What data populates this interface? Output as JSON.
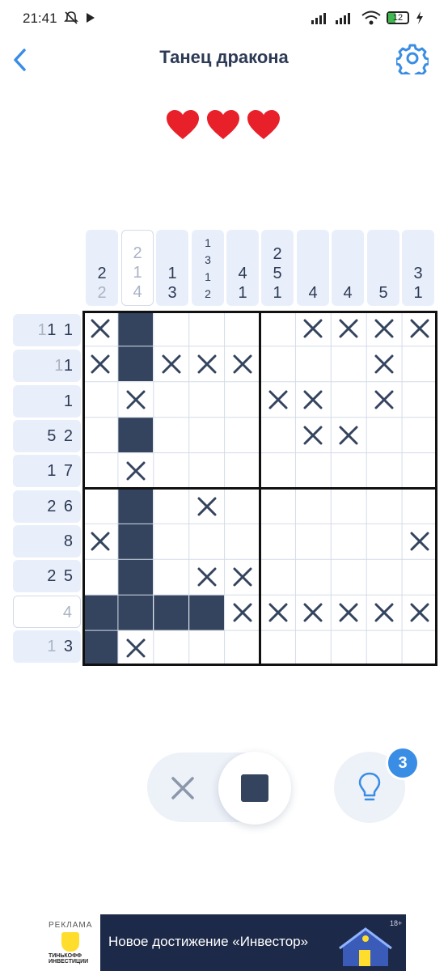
{
  "status_bar": {
    "time": "21:41",
    "battery": "12"
  },
  "header": {
    "title": "Танец дракона"
  },
  "lives": 3,
  "column_clues": [
    {
      "nums": [
        "2",
        "2"
      ],
      "done": false,
      "gray_last": true
    },
    {
      "nums": [
        "2",
        "1",
        "4"
      ],
      "done": true
    },
    {
      "nums": [
        "1",
        "3"
      ],
      "done": false
    },
    {
      "nums": [
        "1",
        "3",
        "1",
        "2"
      ],
      "done": false
    },
    {
      "nums": [
        "4",
        "1"
      ],
      "done": false
    },
    {
      "nums": [
        "2",
        "5",
        "1"
      ],
      "done": false
    },
    {
      "nums": [
        "4"
      ],
      "done": false
    },
    {
      "nums": [
        "4"
      ],
      "done": false
    },
    {
      "nums": [
        "5"
      ],
      "done": false
    },
    {
      "nums": [
        "3",
        "1"
      ],
      "done": false
    }
  ],
  "row_clues": [
    {
      "gray": "1",
      "rest": "1 1",
      "done": false
    },
    {
      "gray": "1",
      "rest": "1",
      "done": false
    },
    {
      "gray": "",
      "rest": "1",
      "done": false
    },
    {
      "gray": "",
      "rest": "5 2",
      "done": false
    },
    {
      "gray": "",
      "rest": "1 7",
      "done": false
    },
    {
      "gray": "",
      "rest": "2 6",
      "done": false
    },
    {
      "gray": "",
      "rest": "8",
      "done": false
    },
    {
      "gray": "",
      "rest": "2 5",
      "done": false
    },
    {
      "gray": "4",
      "rest": "",
      "done": true
    },
    {
      "gray": "1",
      "rest": " 3",
      "done": false
    }
  ],
  "grid": [
    "x#....xxxx",
    "x#xxx...x.",
    ".x...xx.x.",
    ".#....xx..",
    ".x........",
    ".#.x......",
    "x#.......x",
    ".#.xx.....",
    "####xxxxxx",
    "#x........"
  ],
  "controls": {
    "mode": "fill",
    "hints_count": "3"
  },
  "ad": {
    "label": "РЕКЛАМА",
    "brand": "ТИНЬКОФФ ИНВЕСТИЦИИ",
    "text": "Новое достижение «Инвестор»",
    "age": "18+"
  },
  "colors": {
    "filled": "#34445e",
    "accent": "#3a8de4",
    "heart": "#e8202a",
    "clue_bg": "#e9effa"
  }
}
